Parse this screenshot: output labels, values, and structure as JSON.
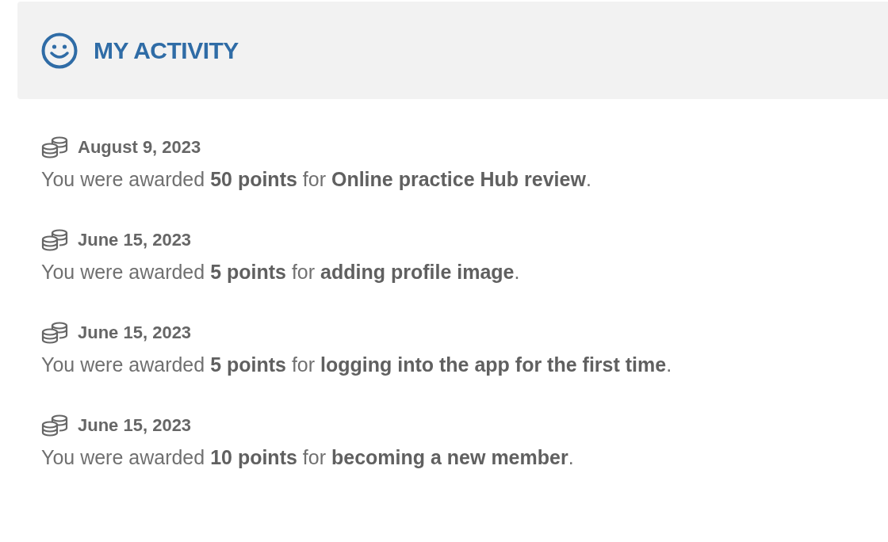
{
  "header": {
    "title": "MY ACTIVITY"
  },
  "activities": [
    {
      "date": "August 9, 2023",
      "text": "You were awarded **50 points** for **Online practice Hub review**."
    },
    {
      "date": "June 15, 2023",
      "text": "You were awarded **5 points** for **adding profile image**."
    },
    {
      "date": "June 15, 2023",
      "text": "You were awarded **5 points** for **logging into the app for the first time**."
    },
    {
      "date": "June 15, 2023",
      "text": "You were awarded **10 points** for **becoming a new member**."
    }
  ]
}
